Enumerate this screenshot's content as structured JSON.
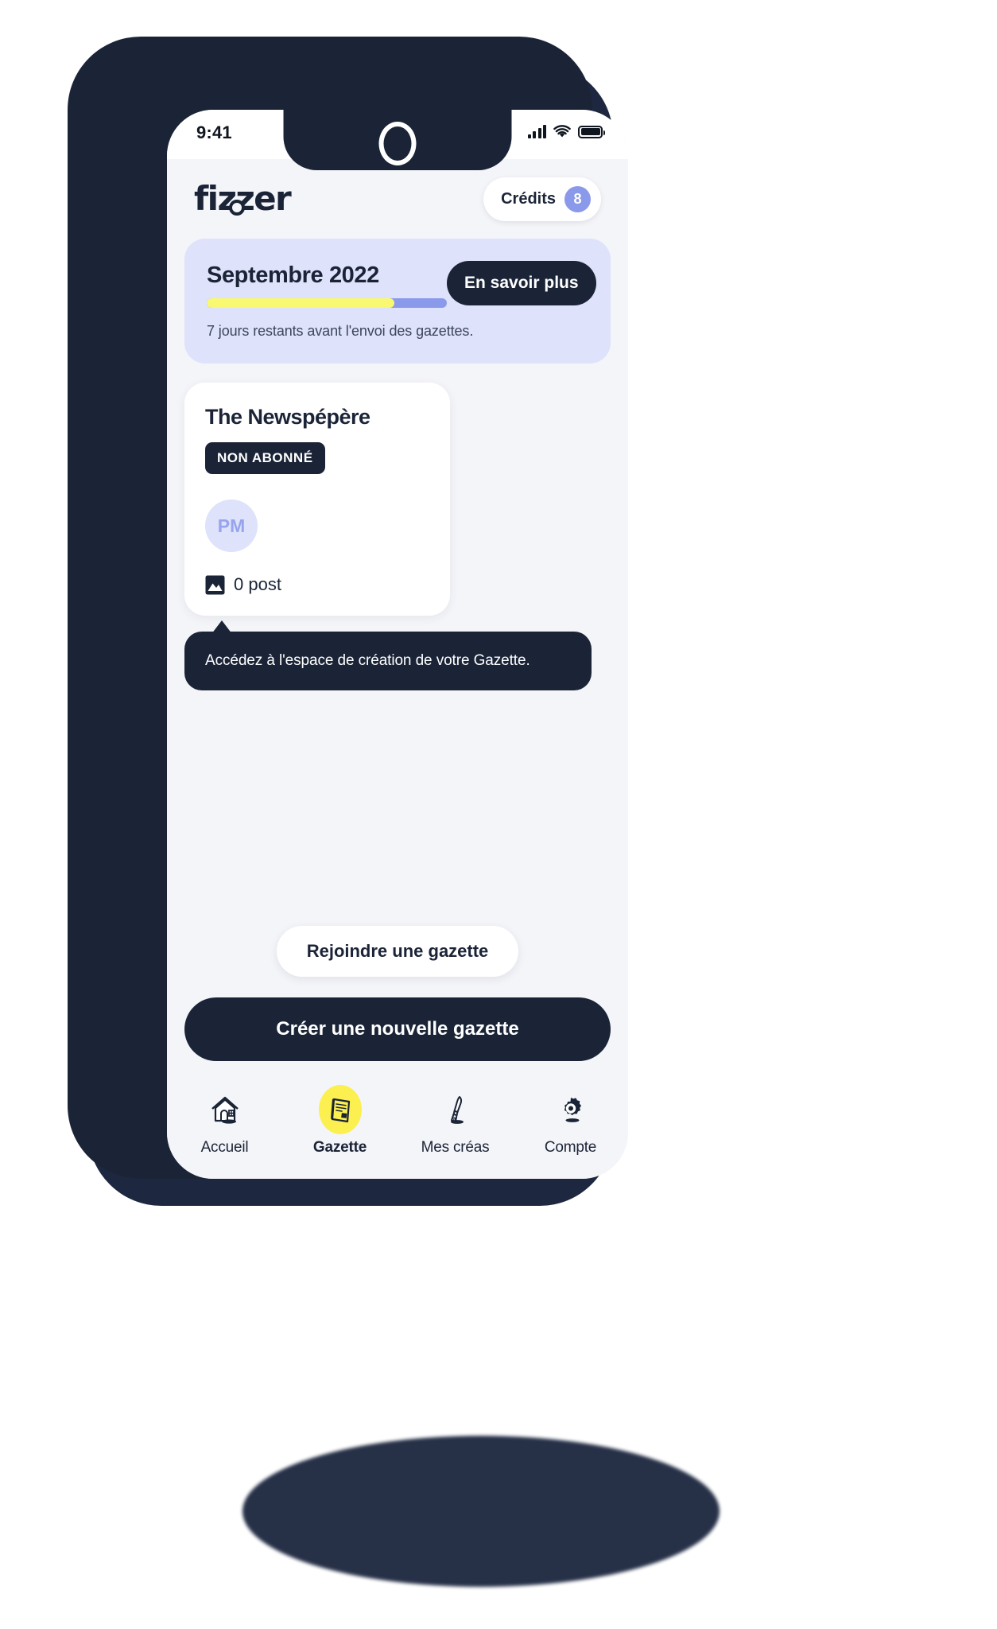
{
  "status_bar": {
    "time": "9:41",
    "icons": [
      "cellular-signal-icon",
      "wifi-icon",
      "battery-icon"
    ]
  },
  "header": {
    "logo_text": "fizzer",
    "credits_label": "Crédits",
    "credits_count": "8"
  },
  "banner": {
    "month": "Septembre 2022",
    "cta_label": "En savoir plus",
    "note": "7 jours restants avant l'envoi des gazettes.",
    "progress_percent": 78
  },
  "gazette_card": {
    "title": "The Newspépère",
    "badge": "NON ABONNÉ",
    "avatar_initials": "PM",
    "post_count_label": "0 post",
    "post_icon": "photo-icon"
  },
  "tooltip": {
    "text": "Accédez à l'espace de création de votre Gazette."
  },
  "actions": {
    "join_label": "Rejoindre une gazette",
    "create_label": "Créer une nouvelle gazette"
  },
  "tab_bar": {
    "tabs": [
      {
        "label": "Accueil",
        "icon": "house-icon",
        "active": false
      },
      {
        "label": "Gazette",
        "icon": "newspaper-icon",
        "active": true
      },
      {
        "label": "Mes créas",
        "icon": "paintbrush-icon",
        "active": false
      },
      {
        "label": "Compte",
        "icon": "gear-icon",
        "active": false
      }
    ]
  },
  "colors": {
    "dark_navy": "#1b2437",
    "screen_bg": "#f4f5f9",
    "periwinkle": "#8a99ea",
    "periwinkle_light": "#dee2fa",
    "yellow": "#f9f871",
    "tab_yellow": "#fbf050"
  }
}
